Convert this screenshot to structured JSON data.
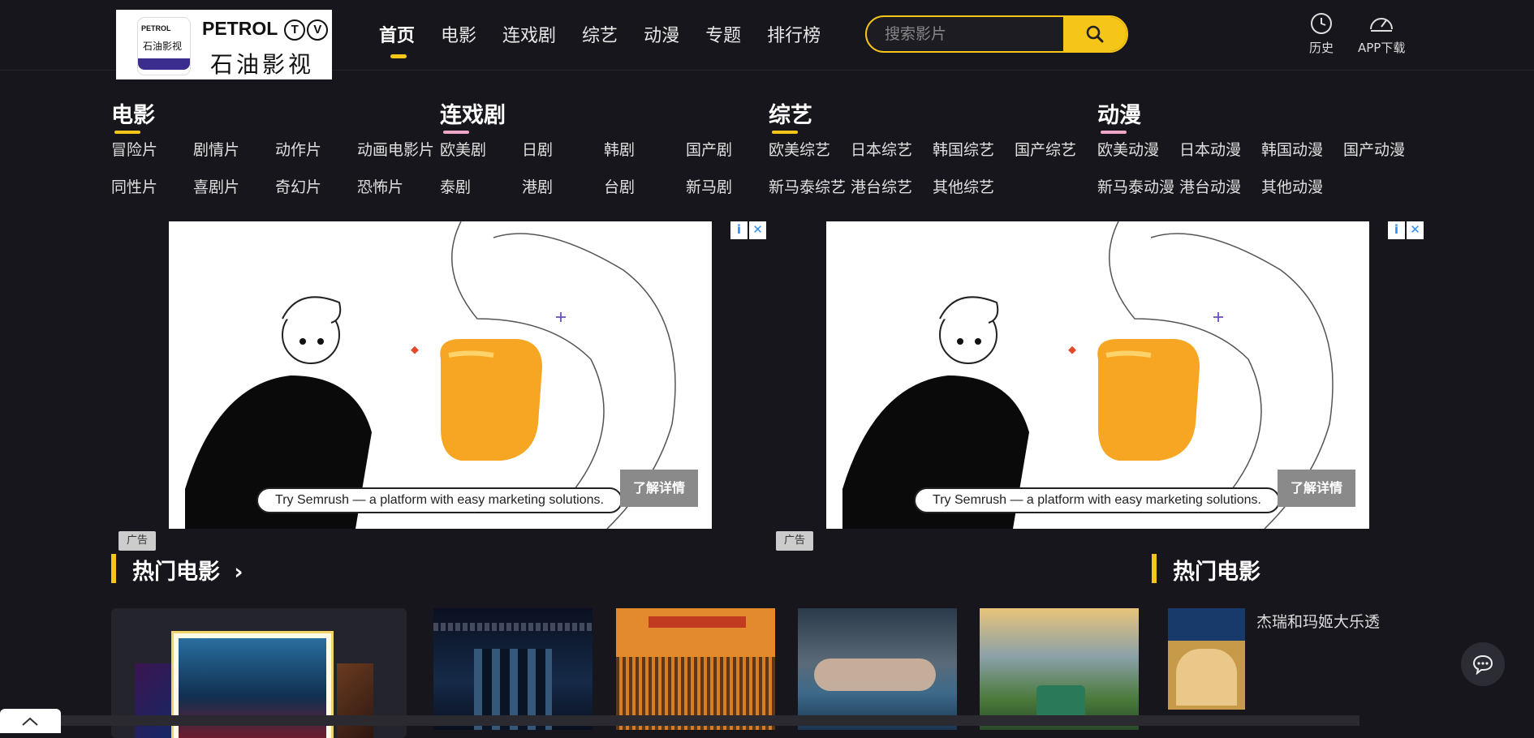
{
  "logo": {
    "badge_top": "PETROL",
    "badge_cn": "石油影视",
    "brand": "PETROL",
    "brand_t": "T",
    "brand_v": "V",
    "cn": "石油影视"
  },
  "nav": [
    {
      "label": "首页",
      "active": true
    },
    {
      "label": "电影"
    },
    {
      "label": "连戏剧"
    },
    {
      "label": "综艺"
    },
    {
      "label": "动漫"
    },
    {
      "label": "专题"
    },
    {
      "label": "排行榜"
    }
  ],
  "search": {
    "placeholder": "搜索影片"
  },
  "tools": {
    "history": "历史",
    "app": "APP下载"
  },
  "categories": [
    {
      "title": "电影",
      "color": "#f5c518",
      "items": [
        "冒险片",
        "剧情片",
        "动作片",
        "动画电影片",
        "同性片",
        "喜剧片",
        "奇幻片",
        "恐怖片"
      ]
    },
    {
      "title": "连戏剧",
      "color": "#f0a8c8",
      "items": [
        "欧美剧",
        "日剧",
        "韩剧",
        "国产剧",
        "泰剧",
        "港剧",
        "台剧",
        "新马剧"
      ]
    },
    {
      "title": "综艺",
      "color": "#f5c518",
      "items": [
        "欧美综艺",
        "日本综艺",
        "韩国综艺",
        "国产综艺",
        "新马泰综艺",
        "港台综艺",
        "其他综艺"
      ]
    },
    {
      "title": "动漫",
      "color": "#f0a8c8",
      "items": [
        "欧美动漫",
        "日本动漫",
        "韩国动漫",
        "国产动漫",
        "新马泰动漫",
        "港台动漫",
        "其他动漫"
      ]
    }
  ],
  "ads": [
    {
      "caption": "Try Semrush — a platform with easy marketing solutions.",
      "cta": "了解详情",
      "label": "广告",
      "info": "i",
      "close": "✕"
    },
    {
      "caption": "Try Semrush — a platform with easy marketing solutions.",
      "cta": "了解详情",
      "label": "广告",
      "info": "i",
      "close": "✕"
    }
  ],
  "sections": {
    "hot_movies": "热门电影",
    "hot_movies_arrow": "›",
    "side_hot": "热门电影"
  },
  "side_list": [
    {
      "title": "杰瑞和玛姬大乐透"
    }
  ],
  "colors": {
    "accent": "#f5c518",
    "bg": "#16161c"
  }
}
